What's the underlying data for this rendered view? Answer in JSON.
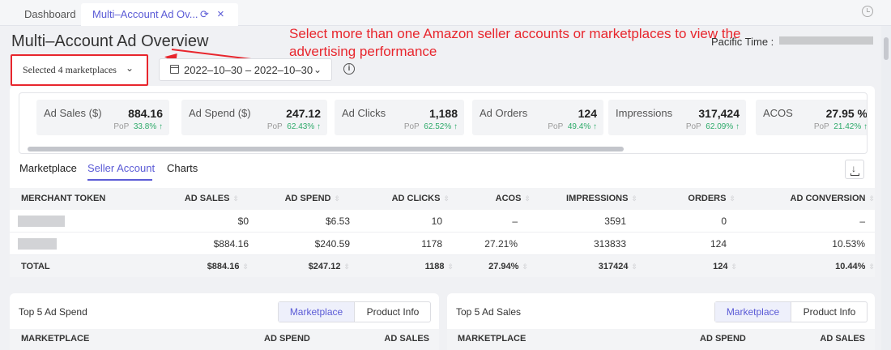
{
  "tabs": [
    {
      "label": "Dashboard"
    },
    {
      "label": "Multi–Account Ad Ov..."
    }
  ],
  "icons": {
    "refresh": "refresh-icon",
    "close": "close-icon",
    "clock": "clock-icon",
    "calendar": "calendar-icon",
    "info": "info-icon",
    "download": "download-icon"
  },
  "colors": {
    "accent": "#5b5bd6",
    "annotation": "#e8262d",
    "positive": "#2eaa6a"
  },
  "page_title": "Multi–Account Ad Overview",
  "timezone_label": "Pacific Time :",
  "annotation": "Select more than one Amazon seller accounts or marketplaces to view the advertising performance",
  "filters": {
    "marketplace_select": "Selected 4 marketplaces",
    "date_range": "2022–10–30 – 2022–10–30"
  },
  "metrics": [
    {
      "label": "Ad Sales ($)",
      "value": "884.16",
      "pop_label": "PoP",
      "pop": "33.8%",
      "arrow": "↑"
    },
    {
      "label": "Ad Spend ($)",
      "value": "247.12",
      "pop_label": "PoP",
      "pop": "62.43%",
      "arrow": "↑"
    },
    {
      "label": "Ad Clicks",
      "value": "1,188",
      "pop_label": "PoP",
      "pop": "62.52%",
      "arrow": "↑"
    },
    {
      "label": "Ad Orders",
      "value": "124",
      "pop_label": "PoP",
      "pop": "49.4%",
      "arrow": "↑"
    },
    {
      "label": "Impressions",
      "value": "317,424",
      "pop_label": "PoP",
      "pop": "62.09%",
      "arrow": "↑"
    },
    {
      "label": "ACOS",
      "value": "27.95 %",
      "pop_label": "PoP",
      "pop": "21.42%",
      "arrow": "↑"
    }
  ],
  "sub_tabs": [
    "Marketplace",
    "Seller Account",
    "Charts"
  ],
  "table": {
    "columns": [
      "MERCHANT TOKEN",
      "AD SALES",
      "AD SPEND",
      "AD CLICKS",
      "ACOS",
      "IMPRESSIONS",
      "ORDERS",
      "AD CONVERSION"
    ],
    "rows": [
      [
        "",
        "$0",
        "$6.53",
        "10",
        "–",
        "3591",
        "0",
        "–"
      ],
      [
        "",
        "$884.16",
        "$240.59",
        "1178",
        "27.21%",
        "313833",
        "124",
        "10.53%"
      ]
    ],
    "total": [
      "TOTAL",
      "$884.16",
      "$247.12",
      "1188",
      "27.94%",
      "317424",
      "124",
      "10.44%"
    ]
  },
  "panels": {
    "top_spend": {
      "title": "Top 5 Ad Spend",
      "seg": [
        "Marketplace",
        "Product Info"
      ],
      "columns": [
        "MARKETPLACE",
        "AD SPEND",
        "AD SALES"
      ]
    },
    "top_sales": {
      "title": "Top 5 Ad Sales",
      "seg": [
        "Marketplace",
        "Product Info"
      ],
      "columns": [
        "MARKETPLACE",
        "AD SPEND",
        "AD SALES"
      ]
    }
  }
}
